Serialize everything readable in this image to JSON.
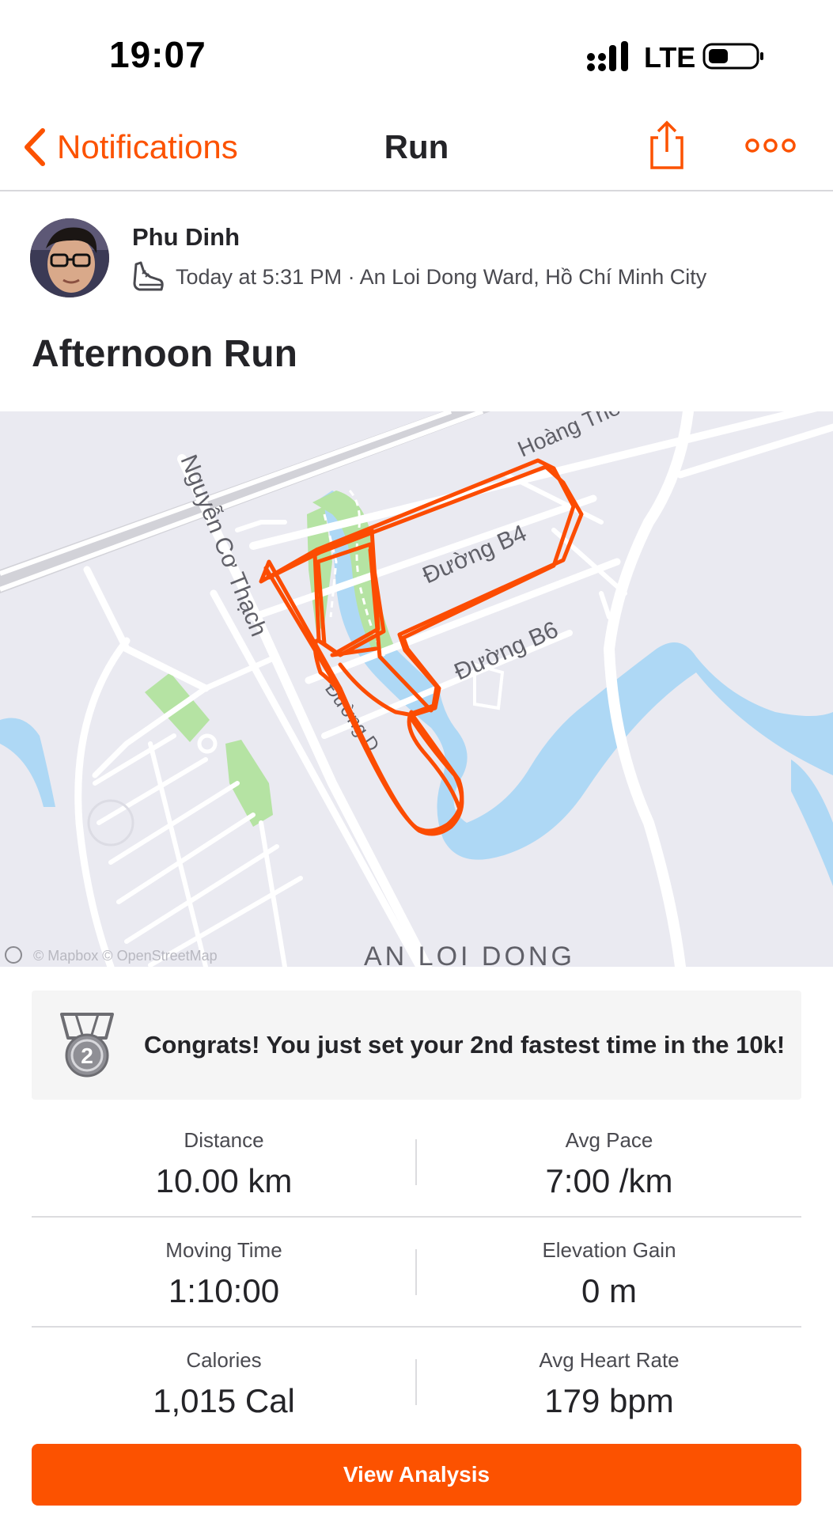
{
  "status_bar": {
    "time": "19:07",
    "network": "LTE",
    "icons": [
      "signal-icon",
      "battery-icon"
    ]
  },
  "nav": {
    "back_label": "Notifications",
    "title": "Run",
    "icons": [
      "chevron-left-icon",
      "share-icon",
      "more-icon"
    ]
  },
  "athlete": {
    "name": "Phu Dinh",
    "meta": "Today at 5:31 PM · An Loi Dong Ward, Hồ Chí Minh City",
    "icon": "shoe-icon"
  },
  "activity": {
    "title": "Afternoon Run"
  },
  "map": {
    "labels": {
      "street_1": "Nguyễn Cơ Thạch",
      "street_2": "Đường B4",
      "street_3": "Đường B6",
      "street_4": "Hoàng Thế",
      "street_5": "Đường D",
      "district": "AN LOI DONG",
      "attribution": "© Mapbox © OpenStreetMap"
    },
    "colors": {
      "route": "#fc4c02",
      "water": "#aed8f5",
      "park": "#b5e3a3",
      "road": "#ffffff",
      "background": "#eaeaf1"
    }
  },
  "achievement": {
    "text": "Congrats! You just set your 2nd fastest time in the 10k!",
    "icon": "silver-medal-icon",
    "rank": "2"
  },
  "stats": [
    {
      "left": {
        "label": "Distance",
        "value": "10.00 km"
      },
      "right": {
        "label": "Avg Pace",
        "value": "7:00 /km"
      }
    },
    {
      "left": {
        "label": "Moving Time",
        "value": "1:10:00"
      },
      "right": {
        "label": "Elevation Gain",
        "value": "0 m"
      }
    },
    {
      "left": {
        "label": "Calories",
        "value": "1,015 Cal"
      },
      "right": {
        "label": "Avg Heart Rate",
        "value": "179 bpm"
      }
    }
  ],
  "cta": {
    "label": "View Analysis"
  },
  "colors": {
    "accent": "#fc5200"
  }
}
